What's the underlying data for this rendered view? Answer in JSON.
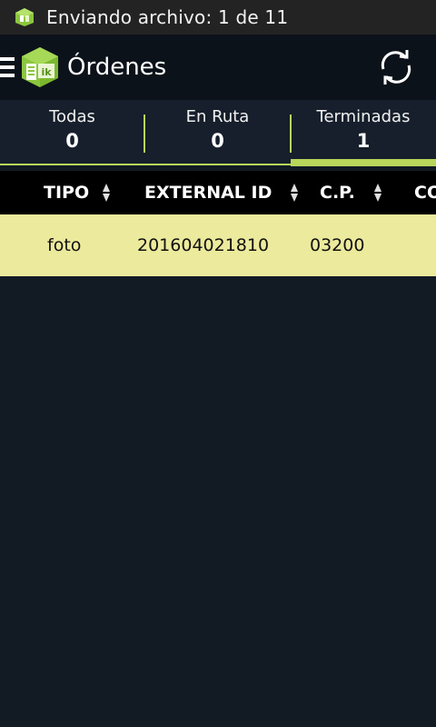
{
  "status_bar": {
    "icon": "app-notification-icon",
    "text": "Enviando archivo: 1 de 11"
  },
  "action_bar": {
    "menu_icon": "hamburger-menu-icon",
    "logo_icon": "app-logo-icon",
    "title": "Órdenes",
    "sync_icon": "sync-icon"
  },
  "tabs": [
    {
      "label": "Todas",
      "count": "0",
      "selected": false
    },
    {
      "label": "En Ruta",
      "count": "0",
      "selected": false
    },
    {
      "label": "Terminadas",
      "count": "1",
      "selected": true
    }
  ],
  "table": {
    "columns": [
      {
        "label": "TIPO",
        "sortable": true
      },
      {
        "label": "EXTERNAL ID",
        "sortable": true
      },
      {
        "label": "C.P.",
        "sortable": true
      },
      {
        "label": "CO",
        "sortable": false
      }
    ],
    "rows": [
      {
        "tipo": "foto",
        "external_id": "201604021810",
        "cp": "03200",
        "co": ""
      }
    ]
  },
  "colors": {
    "accent": "#b7d65a",
    "row_highlight": "#ecea9c",
    "background": "#121a24",
    "action_bar": "#0c121a",
    "status_bar": "#232323"
  }
}
